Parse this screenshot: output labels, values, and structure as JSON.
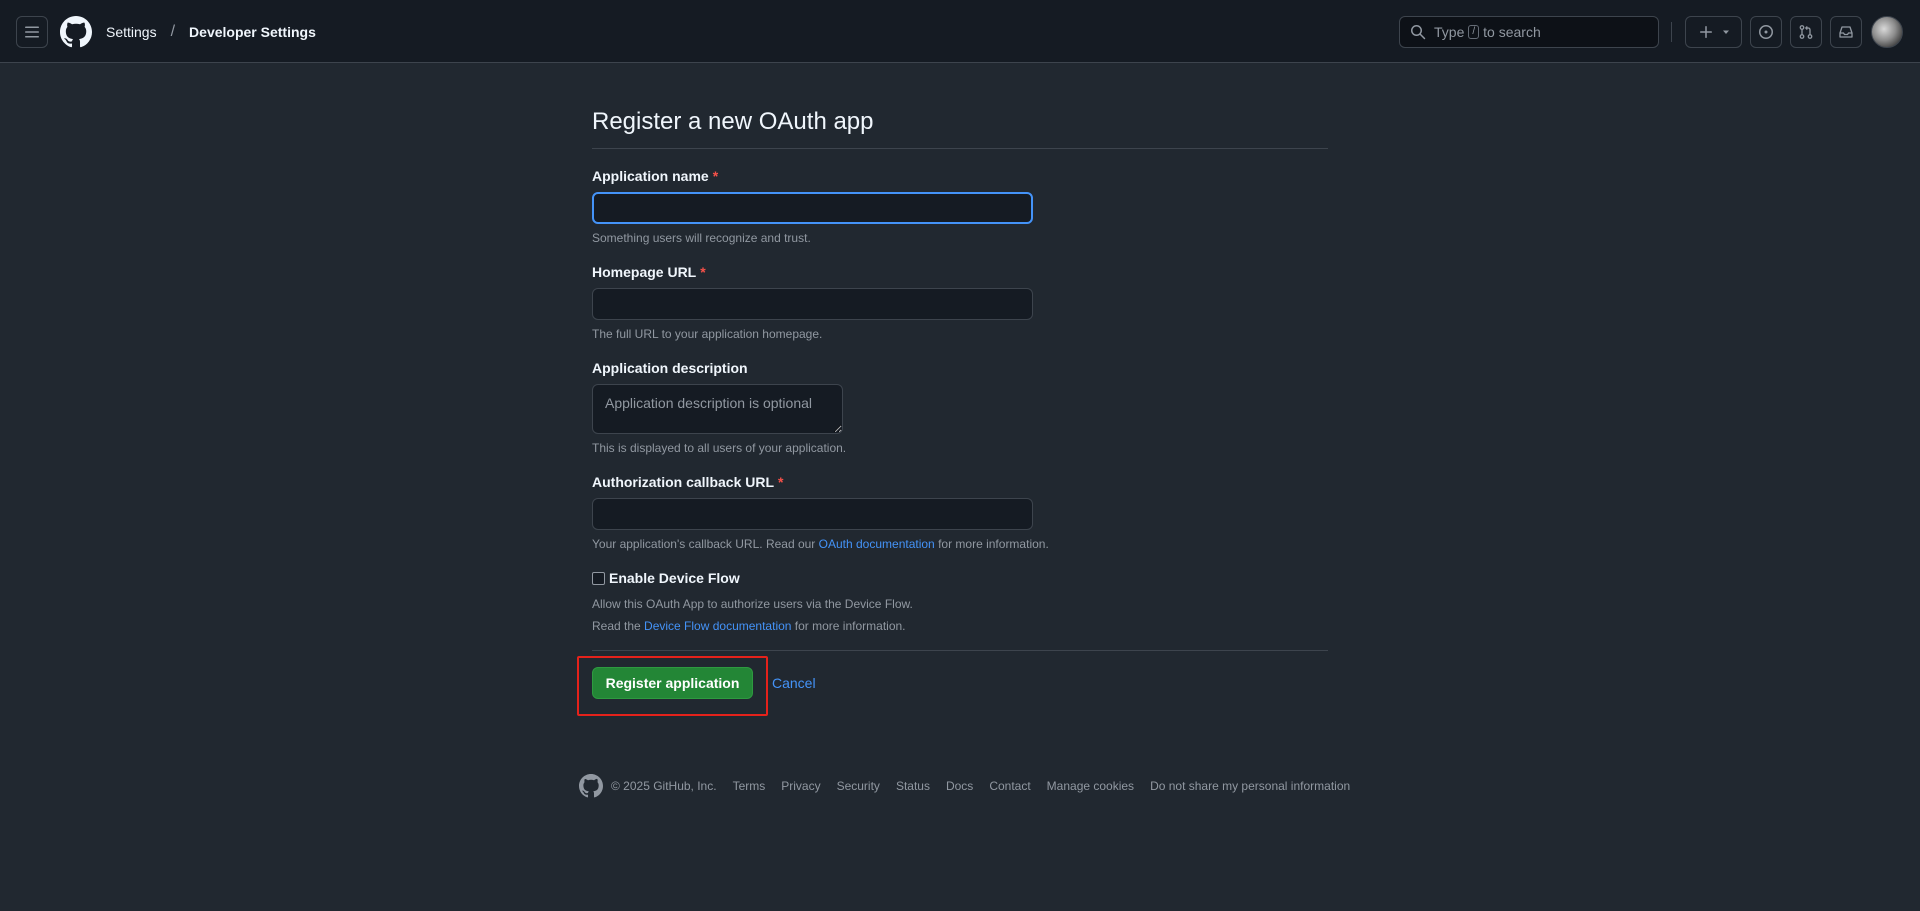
{
  "header": {
    "breadcrumbs": {
      "settings": "Settings",
      "separator": "/",
      "current": "Developer Settings"
    },
    "search": {
      "prefix": "Type",
      "key": "/",
      "suffix": "to search"
    }
  },
  "form": {
    "title": "Register a new OAuth app",
    "app_name": {
      "label": "Application name",
      "required": "*",
      "value": "",
      "hint": "Something users will recognize and trust."
    },
    "homepage": {
      "label": "Homepage URL",
      "required": "*",
      "value": "",
      "hint": "The full URL to your application homepage."
    },
    "description": {
      "label": "Application description",
      "placeholder": "Application description is optional",
      "hint": "This is displayed to all users of your application."
    },
    "callback": {
      "label": "Authorization callback URL",
      "required": "*",
      "value": "",
      "hint_pre": "Your application's callback URL. Read our",
      "hint_link": "OAuth documentation",
      "hint_post": "for more information."
    },
    "device_flow": {
      "label": "Enable Device Flow",
      "checked": false,
      "hint1": "Allow this OAuth App to authorize users via the Device Flow.",
      "hint2_pre": "Read the",
      "hint2_link": "Device Flow documentation",
      "hint2_post": "for more information."
    },
    "submit_label": "Register application",
    "cancel_label": "Cancel"
  },
  "footer": {
    "copyright": "© 2025 GitHub, Inc.",
    "links": [
      "Terms",
      "Privacy",
      "Security",
      "Status",
      "Docs",
      "Contact",
      "Manage cookies",
      "Do not share my personal information"
    ]
  },
  "colors": {
    "page_bg": "#212830",
    "header_bg": "#151b23",
    "accent_link": "#4493f8",
    "primary_button": "#238636",
    "required": "#f85149",
    "highlight_box": "#e5221b"
  },
  "icons": [
    "hamburger-icon",
    "github-logo-icon",
    "search-icon",
    "plus-icon",
    "triangle-down-icon",
    "issue-icon",
    "pull-request-icon",
    "inbox-icon"
  ]
}
